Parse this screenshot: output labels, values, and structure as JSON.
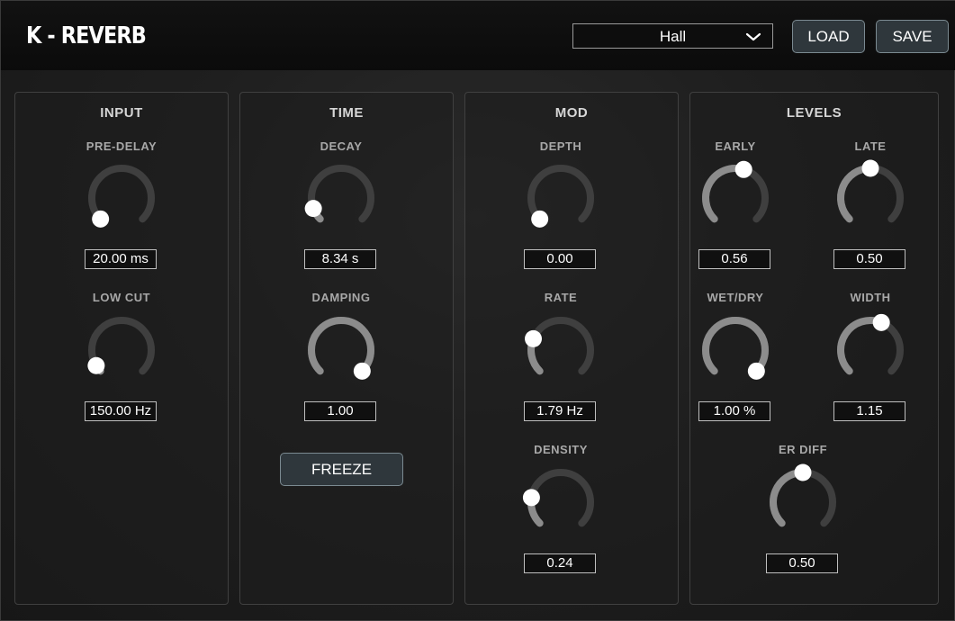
{
  "header": {
    "logo": "K - REVERB",
    "preset": {
      "selected": "Hall"
    },
    "load_label": "LOAD",
    "save_label": "SAVE"
  },
  "panels": {
    "input": {
      "title": "INPUT",
      "pre_delay": {
        "label": "PRE-DELAY",
        "value": "20.00 ms",
        "level": 0.0
      },
      "low_cut": {
        "label": "LOW CUT",
        "value": "150.00 Hz",
        "level": 0.05
      }
    },
    "time": {
      "title": "TIME",
      "decay": {
        "label": "DECAY",
        "value": "8.34 s",
        "level": 0.09
      },
      "damping": {
        "label": "DAMPING",
        "value": "1.00",
        "level": 1.0
      },
      "freeze_label": "FREEZE"
    },
    "mod": {
      "title": "MOD",
      "depth": {
        "label": "DEPTH",
        "value": "0.00",
        "level": 0.0
      },
      "rate": {
        "label": "RATE",
        "value": "1.79 Hz",
        "level": 0.25
      },
      "density": {
        "label": "DENSITY",
        "value": "0.24",
        "level": 0.2
      }
    },
    "levels": {
      "title": "LEVELS",
      "early": {
        "label": "EARLY",
        "value": "0.56",
        "level": 0.56
      },
      "late": {
        "label": "LATE",
        "value": "0.50",
        "level": 0.5
      },
      "wet_dry": {
        "label": "WET/DRY",
        "value": "1.00 %",
        "level": 1.0
      },
      "width": {
        "label": "WIDTH",
        "value": "1.15",
        "level": 0.58
      },
      "er_diff": {
        "label": "ER DIFF",
        "value": "0.50",
        "level": 0.5
      }
    }
  },
  "colors": {
    "knob_track": "#3f3f3f",
    "knob_fill": "#8c8c8c",
    "knob_dot": "#ffffff"
  }
}
